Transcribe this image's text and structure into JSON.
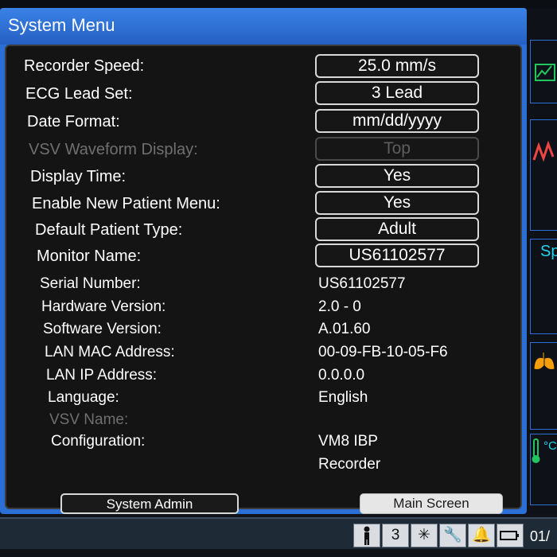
{
  "window": {
    "title": "System Menu"
  },
  "settings": [
    {
      "label": "Recorder Speed:",
      "value": "25.0 mm/s",
      "enabled": true
    },
    {
      "label": "ECG Lead Set:",
      "value": "3 Lead",
      "enabled": true
    },
    {
      "label": "Date Format:",
      "value": "mm/dd/yyyy",
      "enabled": true
    },
    {
      "label": "VSV Waveform Display:",
      "value": "Top",
      "enabled": false
    },
    {
      "label": "Display Time:",
      "value": "Yes",
      "enabled": true
    },
    {
      "label": "Enable New Patient Menu:",
      "value": "Yes",
      "enabled": true
    },
    {
      "label": "Default Patient Type:",
      "value": "Adult",
      "enabled": true
    },
    {
      "label": "Monitor Name:",
      "value": "US61102577",
      "enabled": true
    }
  ],
  "info": [
    {
      "label": "Serial Number:",
      "value": "US61102577"
    },
    {
      "label": "Hardware Version:",
      "value": "2.0 - 0"
    },
    {
      "label": "Software Version:",
      "value": "A.01.60"
    },
    {
      "label": "LAN MAC Address:",
      "value": "00-09-FB-10-05-F6"
    },
    {
      "label": "LAN IP Address:",
      "value": "0.0.0.0"
    },
    {
      "label": "Language:",
      "value": "English"
    },
    {
      "label": "VSV Name:",
      "value": ""
    },
    {
      "label": "Configuration:",
      "value": "VM8 IBP"
    }
  ],
  "configuration_extra": "Recorder",
  "buttons": {
    "system_admin": "System Admin",
    "main_screen": "Main Screen"
  },
  "side": {
    "sp_label": "Sp",
    "temp_label": "°C"
  },
  "statusbar": {
    "number": "3",
    "date_fragment": "01/"
  },
  "icons": [
    "person-icon",
    "lead-3-icon",
    "brightness-icon",
    "wrench-icon",
    "alarm-bell-icon",
    "battery-icon"
  ],
  "colors": {
    "frame_blue": "#2a6fd6",
    "panel_bg": "#141414",
    "cyan": "#22d3ee"
  }
}
